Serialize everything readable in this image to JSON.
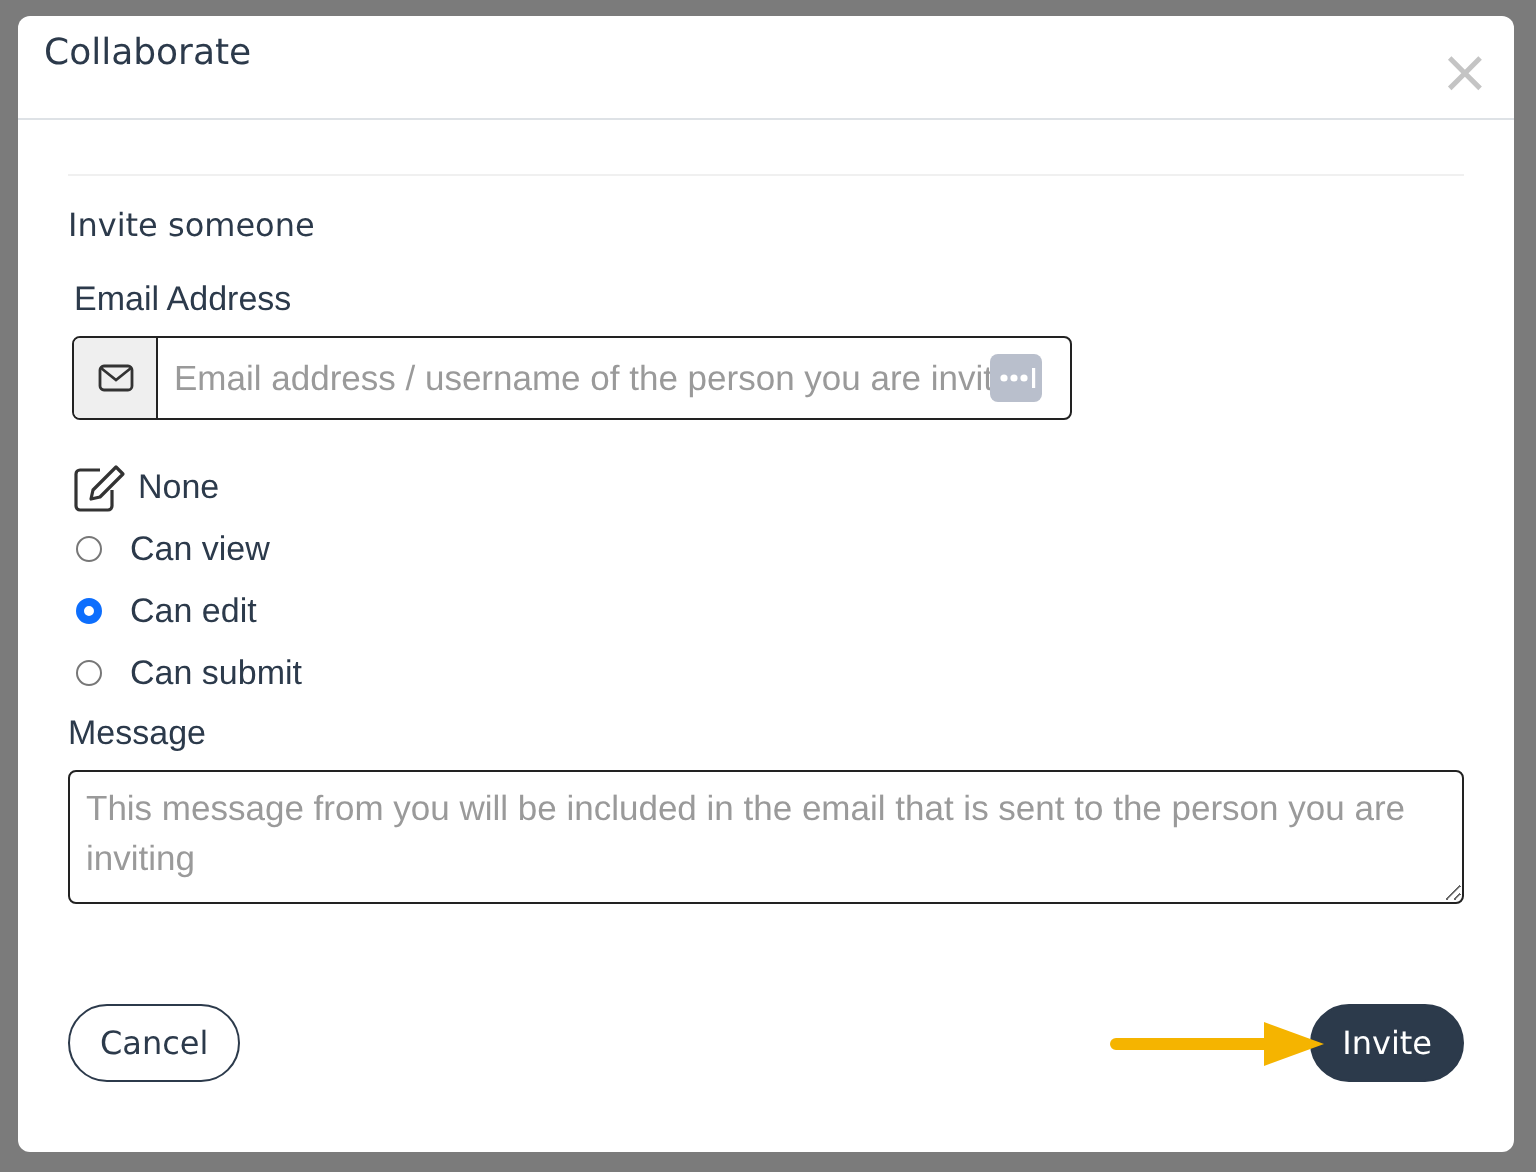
{
  "dialog": {
    "title": "Collaborate",
    "close": "×"
  },
  "section_title": "Invite someone",
  "email": {
    "label": "Email Address",
    "placeholder": "Email address / username of the person you are invit"
  },
  "permissions": [
    {
      "kind": "heading",
      "label": "None"
    },
    {
      "kind": "radio",
      "label": "Can view",
      "selected": false
    },
    {
      "kind": "radio",
      "label": "Can edit",
      "selected": true
    },
    {
      "kind": "radio",
      "label": "Can submit",
      "selected": false
    }
  ],
  "message": {
    "label": "Message",
    "placeholder": "This message from you will be included in the email that is sent to the person you are inviting"
  },
  "buttons": [
    {
      "kind": "secondary",
      "label": "Cancel"
    },
    {
      "kind": "primary",
      "label": "Invite"
    }
  ]
}
